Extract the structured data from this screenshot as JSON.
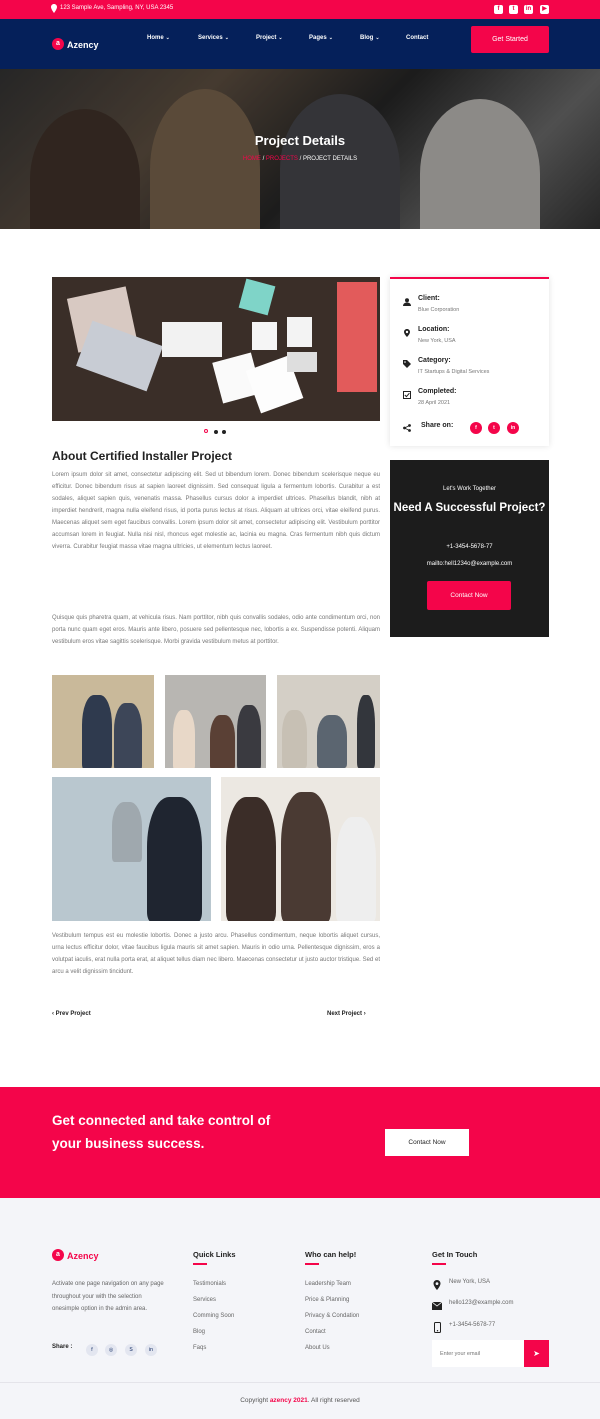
{
  "topbar": {
    "address": "123 Sample Ave, Sampling, NY, USA 2345",
    "social": [
      "facebook-icon",
      "twitter-icon",
      "linkedin-icon",
      "youtube-icon"
    ],
    "social_glyphs": [
      "f",
      "t",
      "in",
      "▶"
    ]
  },
  "nav": {
    "logo_badge": "a",
    "logo_text": "Azency",
    "items": [
      {
        "label": "Home",
        "chevron": "⌄"
      },
      {
        "label": "Services",
        "chevron": "⌄"
      },
      {
        "label": "Project",
        "chevron": "⌄"
      },
      {
        "label": "Pages",
        "chevron": "⌄"
      },
      {
        "label": "Blog",
        "chevron": "⌄"
      },
      {
        "label": "Contact",
        "chevron": ""
      }
    ],
    "cta": "Get Started"
  },
  "hero": {
    "title": "Project Details",
    "crumb_home": "HOME",
    "crumb_sep": " / ",
    "crumb_mid": "PROJECTS",
    "crumb_current": "PROJECT DETAILS"
  },
  "project": {
    "heading": "About Certified Installer Project",
    "para1": "Lorem ipsum dolor sit amet, consectetur adipiscing elit. Sed ut bibendum lorem. Donec bibendum scelerisque neque eu efficitur. Donec bibendum risus at sapien laoreet dignissim. Sed consequat ligula a fermentum lobortis. Curabitur a est sodales, aliquet sapien quis, venenatis massa. Phasellus cursus dolor a imperdiet ultrices. Phasellus blandit, nibh at imperdiet hendrerit, magna nulla eleifend risus, id porta purus lectus at risus. Aliquam at ultrices orci, vitae eleifend purus. Maecenas aliquet sem eget faucibus convallis. Lorem ipsum dolor sit amet, consectetur adipiscing elit. Vestibulum porttitor accumsan lorem in feugiat. Nulla nisi nisl, rhoncus eget molestie ac, lacinia eu magna. Cras fermentum nibh quis dictum viverra. Curabitur feugiat massa vitae magna ultricies, ut elementum lectus laoreet.",
    "para2": "Quisque quis pharetra quam, at vehicula risus. Nam porttitor, nibh quis convallis sodales, odio ante condimentum orci, non porta nunc quam eget eros. Mauris ante libero, posuere sed pellentesque nec, lobortis a ex. Suspendisse potenti. Aliquam vestibulum eros vitae sagittis scelerisque. Morbi gravida vestibulum metus at porttitor.",
    "para3": "Vestibulum tempus est eu molestie lobortis. Donec a justo arcu. Phasellus condimentum, neque lobortis aliquet cursus, urna lectus efficitur dolor, vitae faucibus ligula mauris sit amet sapien. Mauris in odio urna. Pellentesque dignissim, eros a volutpat iaculis, erat nulla porta erat, at aliquet tellus diam nec libero. Maecenas consectetur ut justo auctor tristique. Sed et arcu a velit dignissim tincidunt.",
    "prev": "Prev Project",
    "next": "Next Project",
    "prev_icon": "‹",
    "next_icon": "›"
  },
  "sidebar": {
    "client_label": "Client:",
    "client_value": "Blue Corporation",
    "location_label": "Location:",
    "location_value": "New York, USA",
    "category_label": "Category:",
    "category_value": "IT Startups & Digital Services",
    "completed_label": "Completed:",
    "completed_value": "28 April 2021",
    "share_label": "Share on:",
    "share_glyphs": [
      "f",
      "t",
      "in"
    ]
  },
  "cta_card": {
    "pre": "Let's Work Together",
    "heading": "Need A Successful Project?",
    "phone": "+1-3454-5678-77",
    "email": "mailto:hell1234o@example.com",
    "button": "Contact Now"
  },
  "band": {
    "text": "Get connected and take control of your business success.",
    "button": "Contact Now"
  },
  "footer": {
    "logo_badge": "a",
    "logo_text": "Azency",
    "about": "Activate one page navigation on any page throughout your with the selection onesimple option in the admin area.",
    "share_label": "Share :",
    "share_glyphs": [
      "f",
      "◎",
      "S",
      "in"
    ],
    "quick_links_title": "Quick Links",
    "quick_links": [
      "Testimonials",
      "Services",
      "Comming Soon",
      "Blog",
      "Faqs"
    ],
    "help_title": "Who can help!",
    "help_links": [
      "Leadership Team",
      "Price & Planning",
      "Privacy & Condation",
      "Contact",
      "About Us"
    ],
    "touch_title": "Get In Touch",
    "location": "New York, USA",
    "email": "hello123@example.com",
    "phone": "+1-3454-5678-77",
    "newsletter_placeholder": "Enter your email",
    "send_icon": "➤"
  },
  "copyright": {
    "prefix": "Copyright ",
    "brand": "azency 2021",
    "suffix": ". All right reserved"
  },
  "colors": {
    "accent": "#f4054a",
    "navy": "#05205a"
  }
}
